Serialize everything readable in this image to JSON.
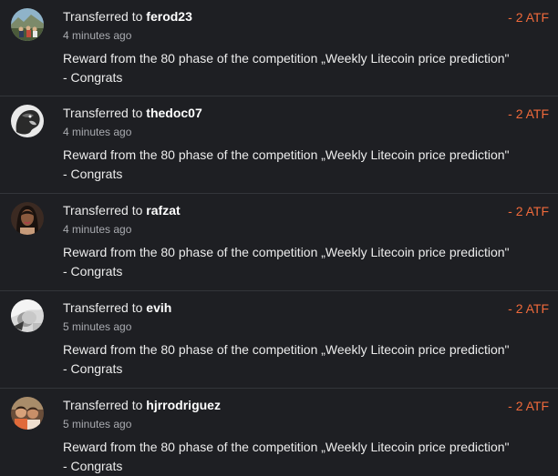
{
  "transactions": [
    {
      "action": "Transferred to",
      "user": "ferod23",
      "time": "4 minutes ago",
      "message": "Reward from the 80 phase of the competition „Weekly Litecoin price prediction\" - Congrats",
      "amount": "- 2 ATF"
    },
    {
      "action": "Transferred to",
      "user": "thedoc07",
      "time": "4 minutes ago",
      "message": "Reward from the 80 phase of the competition „Weekly Litecoin price prediction\" - Congrats",
      "amount": "- 2 ATF"
    },
    {
      "action": "Transferred to",
      "user": "rafzat",
      "time": "4 minutes ago",
      "message": "Reward from the 80 phase of the competition „Weekly Litecoin price prediction\" - Congrats",
      "amount": "- 2 ATF"
    },
    {
      "action": "Transferred to",
      "user": "evih",
      "time": "5 minutes ago",
      "message": "Reward from the 80 phase of the competition „Weekly Litecoin price prediction\" - Congrats",
      "amount": "- 2 ATF"
    },
    {
      "action": "Transferred to",
      "user": "hjrrodriguez",
      "time": "5 minutes ago",
      "message": "Reward from the 80 phase of the competition „Weekly Litecoin price prediction\" - Congrats",
      "amount": "- 2 ATF"
    }
  ],
  "colors": {
    "background": "#1e1f23",
    "amount": "#f06a3b",
    "divider": "#33353a"
  }
}
